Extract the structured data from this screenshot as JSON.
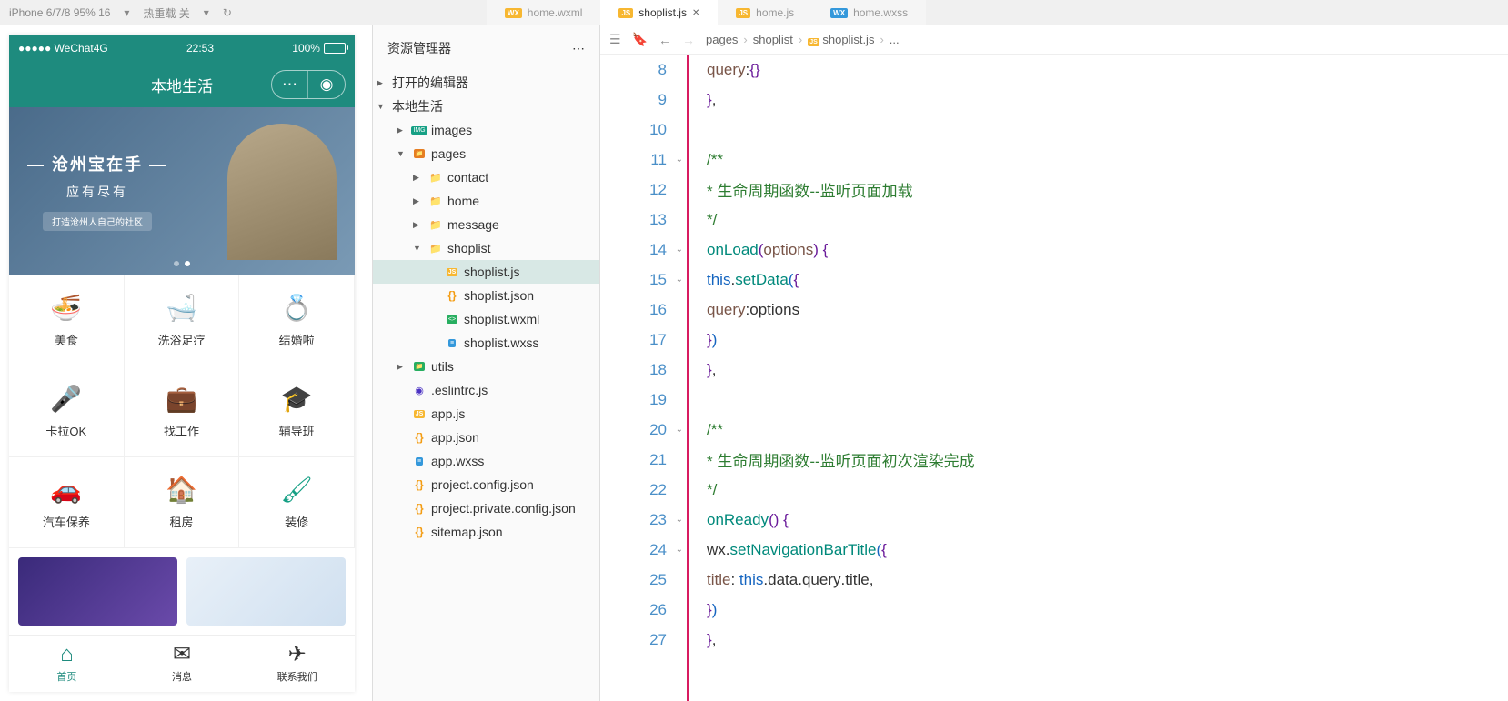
{
  "toolbar": {
    "device": "iPhone 6/7/8 95% 16",
    "network": "热重载 关",
    "tabs": [
      {
        "name": "home.wxml",
        "type": "wxml",
        "active": false
      },
      {
        "name": "shoplist.js",
        "type": "js",
        "active": true
      },
      {
        "name": "home.js",
        "type": "js",
        "active": false
      },
      {
        "name": "home.wxss",
        "type": "wxss",
        "active": false
      }
    ]
  },
  "phone": {
    "carrier": "●●●●● WeChat4G",
    "time": "22:53",
    "battery": "100%",
    "title": "本地生活",
    "banner": {
      "line1": "— 沧州宝在手 —",
      "line2": "应有尽有",
      "sub": "打造沧州人自己的社区"
    },
    "grid": [
      {
        "label": "美食",
        "icon": "🍜",
        "color": "#1e8b7e"
      },
      {
        "label": "洗浴足疗",
        "icon": "🛁",
        "color": "#e67e22"
      },
      {
        "label": "结婚啦",
        "icon": "💍",
        "color": "#f39c12"
      },
      {
        "label": "卡拉OK",
        "icon": "🎤",
        "color": "#e91e63"
      },
      {
        "label": "找工作",
        "icon": "💼",
        "color": "#3498db"
      },
      {
        "label": "辅导班",
        "icon": "🎓",
        "color": "#2c3e50"
      },
      {
        "label": "汽车保养",
        "icon": "🚗",
        "color": "#3498db"
      },
      {
        "label": "租房",
        "icon": "🏠",
        "color": "#e91e63"
      },
      {
        "label": "装修",
        "icon": "🖌",
        "color": "#16a085"
      }
    ],
    "tabbar": [
      {
        "label": "首页",
        "icon": "⌂",
        "active": true
      },
      {
        "label": "消息",
        "icon": "✉",
        "active": false
      },
      {
        "label": "联系我们",
        "icon": "✈",
        "active": false
      }
    ]
  },
  "explorer": {
    "title": "资源管理器",
    "sections": {
      "opened": "打开的编辑器",
      "project": "本地生活"
    },
    "tree": [
      {
        "name": "images",
        "type": "img-folder",
        "indent": 1,
        "chev": "▶"
      },
      {
        "name": "pages",
        "type": "pages-folder",
        "indent": 1,
        "chev": "▼"
      },
      {
        "name": "contact",
        "type": "folder",
        "indent": 2,
        "chev": "▶"
      },
      {
        "name": "home",
        "type": "folder",
        "indent": 2,
        "chev": "▶"
      },
      {
        "name": "message",
        "type": "folder",
        "indent": 2,
        "chev": "▶"
      },
      {
        "name": "shoplist",
        "type": "folder",
        "indent": 2,
        "chev": "▼"
      },
      {
        "name": "shoplist.js",
        "type": "js",
        "indent": 3,
        "selected": true
      },
      {
        "name": "shoplist.json",
        "type": "json",
        "indent": 3
      },
      {
        "name": "shoplist.wxml",
        "type": "wxml",
        "indent": 3
      },
      {
        "name": "shoplist.wxss",
        "type": "wxss",
        "indent": 3
      },
      {
        "name": "utils",
        "type": "utils-folder",
        "indent": 1,
        "chev": "▶"
      },
      {
        "name": ".eslintrc.js",
        "type": "eslint",
        "indent": 1
      },
      {
        "name": "app.js",
        "type": "js",
        "indent": 1
      },
      {
        "name": "app.json",
        "type": "json",
        "indent": 1
      },
      {
        "name": "app.wxss",
        "type": "wxss",
        "indent": 1
      },
      {
        "name": "project.config.json",
        "type": "json",
        "indent": 1
      },
      {
        "name": "project.private.config.json",
        "type": "json",
        "indent": 1
      },
      {
        "name": "sitemap.json",
        "type": "json",
        "indent": 1
      }
    ]
  },
  "editor": {
    "breadcrumb": [
      "pages",
      "shoplist",
      "shoplist.js",
      "..."
    ],
    "lines": [
      {
        "num": 8,
        "indent": "    ",
        "tokens": [
          [
            "query",
            "brown"
          ],
          [
            ":",
            "black"
          ],
          [
            "{}",
            "purple"
          ]
        ]
      },
      {
        "num": 9,
        "indent": "  ",
        "tokens": [
          [
            "}",
            "purple"
          ],
          [
            ",",
            "black"
          ]
        ]
      },
      {
        "num": 10,
        "indent": "",
        "tokens": []
      },
      {
        "num": 11,
        "fold": true,
        "indent": "  ",
        "tokens": [
          [
            "/**",
            "green"
          ]
        ]
      },
      {
        "num": 12,
        "indent": "   ",
        "tokens": [
          [
            "* 生命周期函数--监听页面加载",
            "green"
          ]
        ]
      },
      {
        "num": 13,
        "indent": "   ",
        "tokens": [
          [
            "*/",
            "green"
          ]
        ]
      },
      {
        "num": 14,
        "fold": true,
        "indent": "  ",
        "tokens": [
          [
            "onLoad",
            "teal"
          ],
          [
            "(",
            "purple"
          ],
          [
            "options",
            "brown"
          ],
          [
            ")",
            "purple"
          ],
          [
            " ",
            "black"
          ],
          [
            "{",
            "purple"
          ]
        ]
      },
      {
        "num": 15,
        "fold": true,
        "indent": "    ",
        "tokens": [
          [
            "this",
            "blue"
          ],
          [
            ".",
            "black"
          ],
          [
            "setData",
            "teal"
          ],
          [
            "(",
            "blue"
          ],
          [
            "{",
            "purple"
          ]
        ]
      },
      {
        "num": 16,
        "indent": "      ",
        "tokens": [
          [
            "query",
            "brown"
          ],
          [
            ":",
            "black"
          ],
          [
            "options",
            "black"
          ]
        ]
      },
      {
        "num": 17,
        "indent": "    ",
        "tokens": [
          [
            "}",
            "purple"
          ],
          [
            ")",
            "blue"
          ]
        ]
      },
      {
        "num": 18,
        "indent": "  ",
        "tokens": [
          [
            "}",
            "purple"
          ],
          [
            ",",
            "black"
          ]
        ]
      },
      {
        "num": 19,
        "indent": "",
        "tokens": []
      },
      {
        "num": 20,
        "fold": true,
        "indent": "  ",
        "tokens": [
          [
            "/**",
            "green"
          ]
        ]
      },
      {
        "num": 21,
        "indent": "   ",
        "tokens": [
          [
            "* 生命周期函数--监听页面初次渲染完成",
            "green"
          ]
        ]
      },
      {
        "num": 22,
        "indent": "   ",
        "tokens": [
          [
            "*/",
            "green"
          ]
        ]
      },
      {
        "num": 23,
        "fold": true,
        "indent": "  ",
        "tokens": [
          [
            "onReady",
            "teal"
          ],
          [
            "()",
            "purple"
          ],
          [
            " ",
            "black"
          ],
          [
            "{",
            "purple"
          ]
        ]
      },
      {
        "num": 24,
        "fold": true,
        "indent": "    ",
        "tokens": [
          [
            "wx",
            "black"
          ],
          [
            ".",
            "black"
          ],
          [
            "setNavigationBarTitle",
            "teal"
          ],
          [
            "(",
            "blue"
          ],
          [
            "{",
            "purple"
          ]
        ]
      },
      {
        "num": 25,
        "indent": "      ",
        "tokens": [
          [
            "title",
            "brown"
          ],
          [
            ": ",
            "black"
          ],
          [
            "this",
            "blue"
          ],
          [
            ".",
            "black"
          ],
          [
            "data",
            "black"
          ],
          [
            ".",
            "black"
          ],
          [
            "query",
            "black"
          ],
          [
            ".",
            "black"
          ],
          [
            "title",
            "black"
          ],
          [
            ",",
            "black"
          ]
        ]
      },
      {
        "num": 26,
        "indent": "    ",
        "tokens": [
          [
            "}",
            "purple"
          ],
          [
            ")",
            "blue"
          ]
        ]
      },
      {
        "num": 27,
        "indent": "  ",
        "tokens": [
          [
            "}",
            "purple"
          ],
          [
            ",",
            "black"
          ]
        ]
      }
    ]
  }
}
